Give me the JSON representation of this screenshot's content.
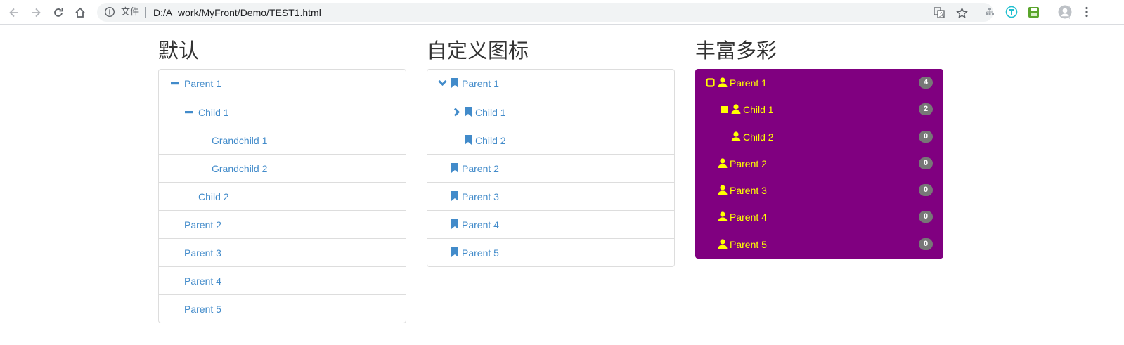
{
  "browser": {
    "file_label": "文件",
    "url": "D:/A_work/MyFront/Demo/TEST1.html"
  },
  "colors": {
    "link": "#428bca",
    "rich_bg": "#800080",
    "rich_text": "#ffff00",
    "badge_bg": "#777777"
  },
  "default_tree": {
    "title": "默认",
    "nodes": [
      {
        "label": "Parent 1",
        "icon": "minus-icon"
      },
      {
        "label": "Child 1",
        "icon": "minus-icon"
      },
      {
        "label": "Grandchild 1"
      },
      {
        "label": "Grandchild 2"
      },
      {
        "label": "Child 2"
      },
      {
        "label": "Parent 2"
      },
      {
        "label": "Parent 3"
      },
      {
        "label": "Parent 4"
      },
      {
        "label": "Parent 5"
      }
    ]
  },
  "custom_tree": {
    "title": "自定义图标",
    "nodes": [
      {
        "label": "Parent 1",
        "icon": "chevron-down-icon"
      },
      {
        "label": "Child 1",
        "icon": "chevron-right-icon"
      },
      {
        "label": "Child 2"
      },
      {
        "label": "Parent 2"
      },
      {
        "label": "Parent 3"
      },
      {
        "label": "Parent 4"
      },
      {
        "label": "Parent 5"
      }
    ]
  },
  "rich_tree": {
    "title": "丰富多彩",
    "nodes": [
      {
        "label": "Parent 1",
        "badge": "4",
        "icon": "unchecked-box-icon"
      },
      {
        "label": "Child 1",
        "badge": "2",
        "icon": "filled-square-icon"
      },
      {
        "label": "Child 2",
        "badge": "0"
      },
      {
        "label": "Parent 2",
        "badge": "0"
      },
      {
        "label": "Parent 3",
        "badge": "0"
      },
      {
        "label": "Parent 4",
        "badge": "0"
      },
      {
        "label": "Parent 5",
        "badge": "0"
      }
    ]
  }
}
